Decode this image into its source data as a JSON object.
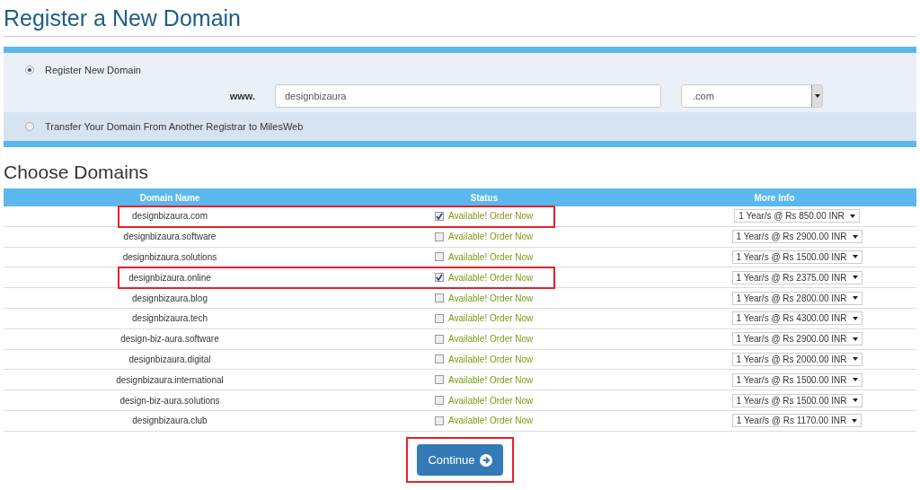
{
  "title": "Register a New Domain",
  "register_options": [
    {
      "label": "Register New Domain",
      "selected": true
    },
    {
      "label": "Transfer Your Domain From Another Registrar to MilesWeb",
      "selected": false
    }
  ],
  "domain_input": {
    "prefix": "www.",
    "value": "designbizaura",
    "tld": ".com"
  },
  "section_title": "Choose Domains",
  "table": {
    "columns": [
      "Domain Name",
      "Status",
      "More Info"
    ],
    "rows": [
      {
        "domain": "designbizaura.com",
        "checked": true,
        "status": "Available! Order Now",
        "price": "1 Year/s @ Rs 850.00 INR",
        "highlighted": true
      },
      {
        "domain": "designbizaura.software",
        "checked": false,
        "status": "Available! Order Now",
        "price": "1 Year/s @ Rs 2900.00 INR",
        "highlighted": false
      },
      {
        "domain": "designbizaura.solutions",
        "checked": false,
        "status": "Available! Order Now",
        "price": "1 Year/s @ Rs 1500.00 INR",
        "highlighted": false
      },
      {
        "domain": "designbizaura.online",
        "checked": true,
        "status": "Available! Order Now",
        "price": "1 Year/s @ Rs 2375.00 INR",
        "highlighted": true
      },
      {
        "domain": "designbizaura.blog",
        "checked": false,
        "status": "Available! Order Now",
        "price": "1 Year/s @ Rs 2800.00 INR",
        "highlighted": false
      },
      {
        "domain": "designbizaura.tech",
        "checked": false,
        "status": "Available! Order Now",
        "price": "1 Year/s @ Rs 4300.00 INR",
        "highlighted": false
      },
      {
        "domain": "design-biz-aura.software",
        "checked": false,
        "status": "Available! Order Now",
        "price": "1 Year/s @ Rs 2900.00 INR",
        "highlighted": false
      },
      {
        "domain": "designbizaura.digital",
        "checked": false,
        "status": "Available! Order Now",
        "price": "1 Year/s @ Rs 2000.00 INR",
        "highlighted": false
      },
      {
        "domain": "designbizaura.international",
        "checked": false,
        "status": "Available! Order Now",
        "price": "1 Year/s @ Rs 1500.00 INR",
        "highlighted": false
      },
      {
        "domain": "design-biz-aura.solutions",
        "checked": false,
        "status": "Available! Order Now",
        "price": "1 Year/s @ Rs 1500.00 INR",
        "highlighted": false
      },
      {
        "domain": "designbizaura.club",
        "checked": false,
        "status": "Available! Order Now",
        "price": "1 Year/s @ Rs 1170.00 INR",
        "highlighted": false
      }
    ]
  },
  "continue_button": {
    "label": "Continue",
    "highlighted": true
  }
}
